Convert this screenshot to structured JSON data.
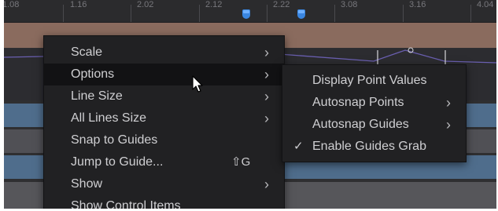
{
  "ruler": {
    "ticks": [
      "1.08",
      "1.16",
      "2.02",
      "2.12",
      "2.22",
      "3.08",
      "3.16",
      "4.04"
    ],
    "guide_markers": 2
  },
  "context_menu": {
    "items": [
      {
        "label": "Scale",
        "submenu": true
      },
      {
        "label": "Options",
        "submenu": true,
        "highlighted": true
      },
      {
        "label": "Line Size",
        "submenu": true
      },
      {
        "label": "All Lines Size",
        "submenu": true
      },
      {
        "label": "Snap to Guides"
      },
      {
        "label": "Jump to Guide...",
        "shortcut": "⇧G"
      },
      {
        "label": "Show",
        "submenu": true
      },
      {
        "label": "Show Control Items"
      }
    ]
  },
  "options_submenu": {
    "items": [
      {
        "label": "Display Point Values"
      },
      {
        "label": "Autosnap Points",
        "submenu": true
      },
      {
        "label": "Autosnap Guides",
        "submenu": true
      },
      {
        "label": "Enable Guides Grab",
        "checked": true
      }
    ]
  },
  "icons": {
    "submenu_arrow": "chevron-right-icon",
    "check": "checkmark-icon",
    "cursor": "mouse-pointer-icon",
    "guide_marker": "guide-marker-icon"
  },
  "colors": {
    "menu_bg": "#212123",
    "highlight_bg": "#121214",
    "menu_text": "#cfcfd2",
    "guide_marker": "#3a86e0",
    "track_orange": "#8a6b5e",
    "track_blue": "#4f6d8c"
  }
}
